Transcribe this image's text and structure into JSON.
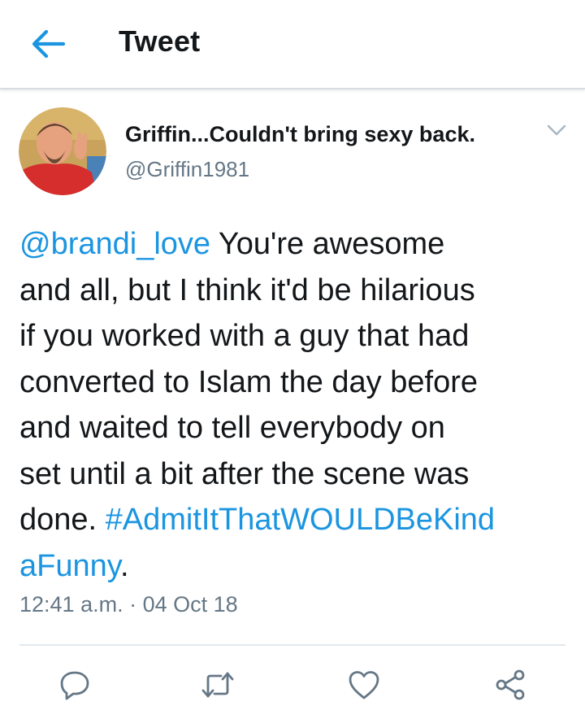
{
  "header": {
    "title": "Tweet",
    "back_icon": "arrow-left-icon",
    "accent_color": "#1b95e0"
  },
  "tweet": {
    "author": {
      "display_name": "Griffin...Couldn't bring sexy back.",
      "handle": "@Griffin1981",
      "avatar_icon": "profile-photo"
    },
    "menu_icon": "chevron-down-icon",
    "text_lines": [
      [
        {
          "text": "@brandi_love",
          "link": true
        },
        {
          "text": " You're awesome",
          "link": false
        }
      ],
      [
        {
          "text": "and all, but I think it'd be hilarious",
          "link": false
        }
      ],
      [
        {
          "text": "if you worked with a guy that had",
          "link": false
        }
      ],
      [
        {
          "text": "converted to Islam the day before",
          "link": false
        }
      ],
      [
        {
          "text": "and waited to tell everybody on",
          "link": false
        }
      ],
      [
        {
          "text": "set until a bit after the scene was",
          "link": false
        }
      ],
      [
        {
          "text": "done. ",
          "link": false
        },
        {
          "text": "#AdmitItThatWOULDBeKind",
          "link": true
        }
      ],
      [
        {
          "text": "aFunny",
          "link": true
        },
        {
          "text": ".",
          "link": false
        }
      ]
    ],
    "timestamp": "12:41 a.m. · 04 Oct 18"
  },
  "actions": [
    {
      "name": "reply-button",
      "icon": "reply-icon"
    },
    {
      "name": "retweet-button",
      "icon": "retweet-icon"
    },
    {
      "name": "like-button",
      "icon": "heart-icon"
    },
    {
      "name": "share-button",
      "icon": "share-icon"
    }
  ],
  "colors": {
    "link": "#1b95e0",
    "secondary_text": "#657786",
    "primary_text": "#14171a",
    "divider": "#e1e8ed"
  }
}
